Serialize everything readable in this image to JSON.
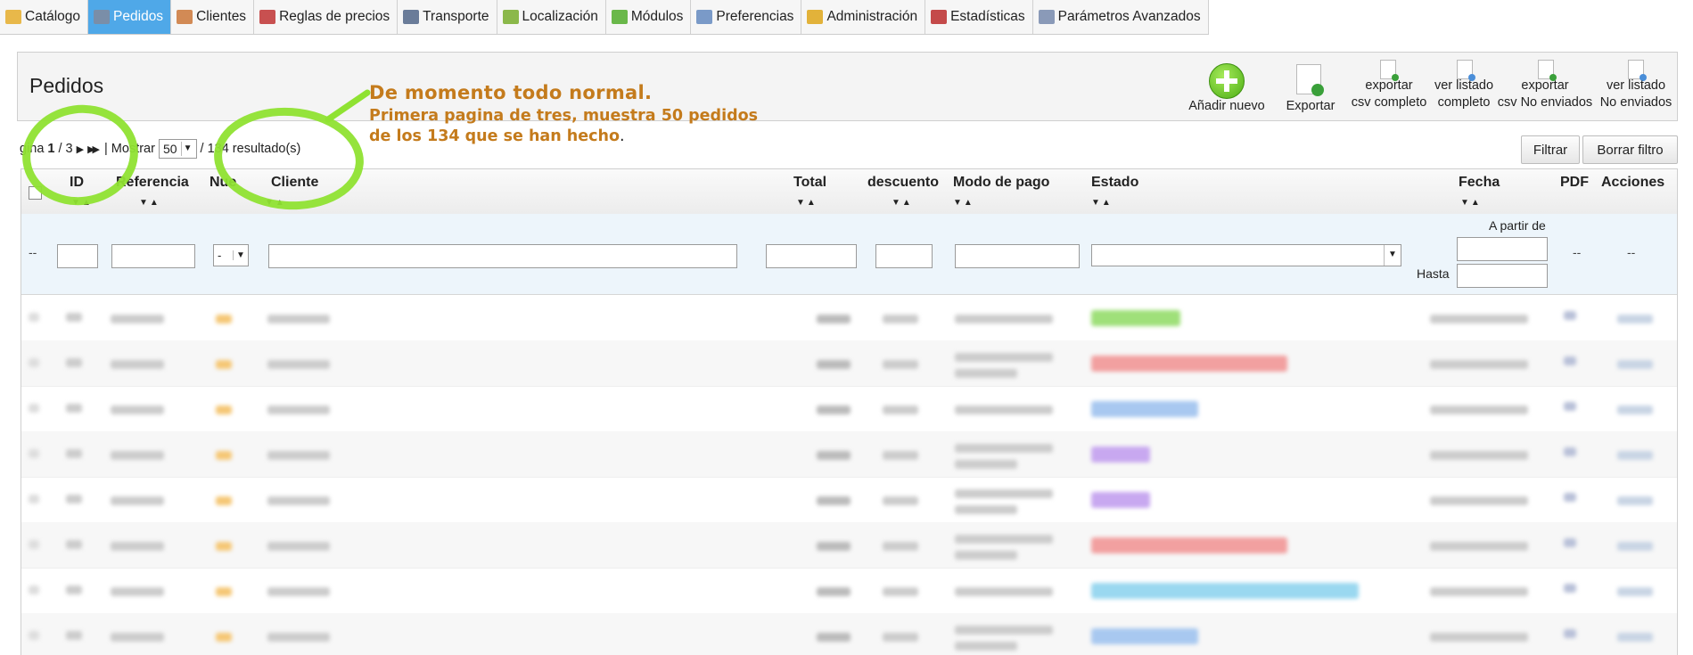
{
  "tabs": [
    {
      "label": "Catálogo",
      "icon": "folder-icon",
      "color": "#e8b84a"
    },
    {
      "label": "Pedidos",
      "icon": "cart-icon",
      "color": "#7a8ea8",
      "active": true
    },
    {
      "label": "Clientes",
      "icon": "user-icon",
      "color": "#d28a55"
    },
    {
      "label": "Reglas de precios",
      "icon": "price-rules-icon",
      "color": "#c85050"
    },
    {
      "label": "Transporte",
      "icon": "truck-icon",
      "color": "#6a7c99"
    },
    {
      "label": "Localización",
      "icon": "globe-icon",
      "color": "#8bb84a"
    },
    {
      "label": "Módulos",
      "icon": "puzzle-icon",
      "color": "#6ab84a"
    },
    {
      "label": "Preferencias",
      "icon": "preferences-icon",
      "color": "#7a9ac8"
    },
    {
      "label": "Administración",
      "icon": "key-icon",
      "color": "#e2b23a"
    },
    {
      "label": "Estadísticas",
      "icon": "bar-chart-icon",
      "color": "#c44a4a"
    },
    {
      "label": "Parámetros Avanzados",
      "icon": "wrench-icon",
      "color": "#8a9ab8"
    }
  ],
  "page_title": "Pedidos",
  "toolbar": {
    "add": "Añadir nuevo",
    "export": "Exportar",
    "export_csv_1": "exportar",
    "export_csv_2": "csv completo",
    "view_list_1": "ver listado",
    "view_list_2": "completo",
    "export_unsent_1": "exportar",
    "export_unsent_2": "csv No enviados",
    "view_unsent_1": "ver listado",
    "view_unsent_2": "No enviados"
  },
  "annotation": {
    "line1": "De momento todo normal.",
    "line2": "Primera pagina de tres, muestra 50 pedidos",
    "line3": "de los 134 que se han hecho",
    "line3_end": "."
  },
  "pagination": {
    "page_label": "gina",
    "current": "1",
    "sep": "/",
    "total": "3",
    "show_label": "| Mostrar",
    "per_page": "50",
    "results": "/ 134 resultado(s)"
  },
  "buttons": {
    "filter": "Filtrar",
    "reset": "Borrar filtro"
  },
  "columns": {
    "id": "ID",
    "reference": "Referencia",
    "new": "Nue",
    "customer": "Cliente",
    "total": "Total",
    "discount": "descuento",
    "payment": "Modo de pago",
    "status": "Estado",
    "date": "Fecha",
    "pdf": "PDF",
    "actions": "Acciones"
  },
  "filters": {
    "from_label": "A partir de",
    "to_label": "Hasta",
    "new_select": "-",
    "dash": "--"
  },
  "status_colors": [
    "#9fe07a",
    "#f2a0a0",
    "#a8c8f0",
    "#c8a8f0",
    "#c8a8f0",
    "#f2a0a0",
    "#9ad8f0",
    "#a8c8f0"
  ],
  "annotation_color": "#c47b1c",
  "highlight_color": "#8fe232"
}
